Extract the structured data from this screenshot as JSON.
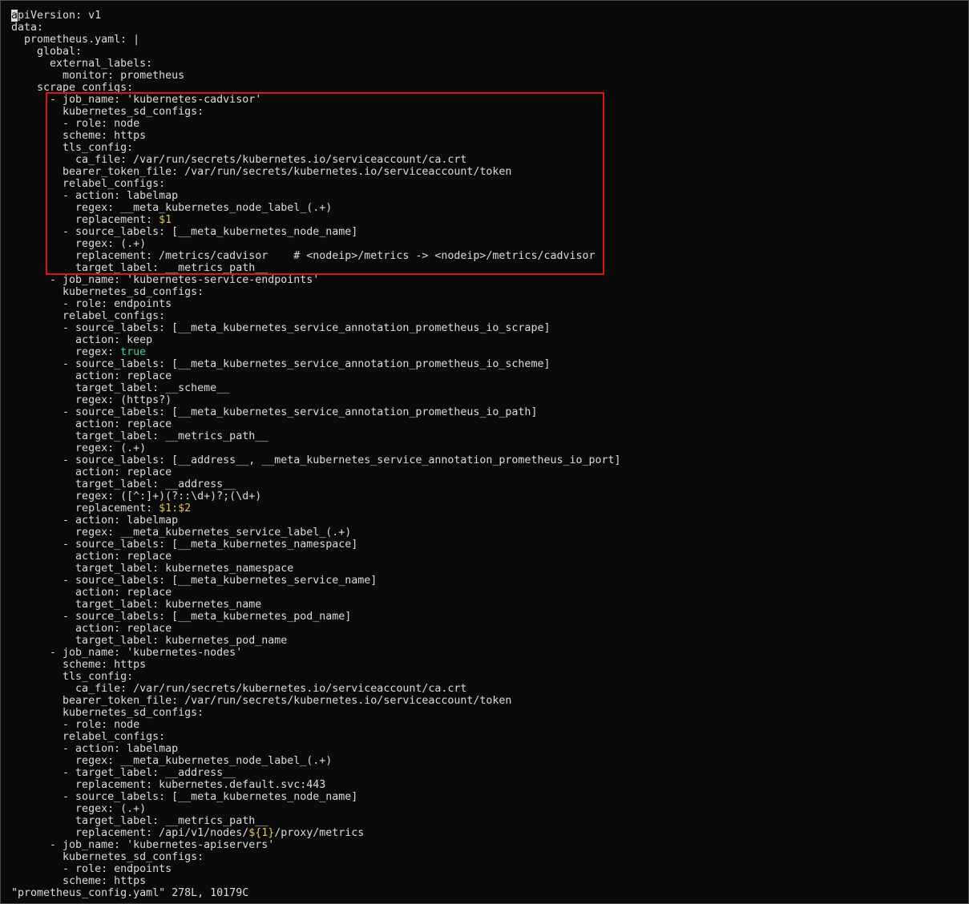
{
  "editor": {
    "lines": [
      "apiVersion: v1",
      "data:",
      "  prometheus.yaml: |",
      "    global:",
      "      external_labels:",
      "        monitor: prometheus",
      "    scrape_configs:",
      "      - job_name: 'kubernetes-cadvisor'",
      "        kubernetes_sd_configs:",
      "        - role: node",
      "        scheme: https",
      "        tls_config:",
      "          ca_file: /var/run/secrets/kubernetes.io/serviceaccount/ca.crt",
      "        bearer_token_file: /var/run/secrets/kubernetes.io/serviceaccount/token",
      "        relabel_configs:",
      "        - action: labelmap",
      "          regex: __meta_kubernetes_node_label_(.+)",
      "          replacement: $1",
      "        - source_labels: [__meta_kubernetes_node_name]",
      "          regex: (.+)",
      "          replacement: /metrics/cadvisor    # <nodeip>/metrics -> <nodeip>/metrics/cadvisor",
      "          target_label: __metrics_path__",
      "      - job_name: 'kubernetes-service-endpoints'",
      "        kubernetes_sd_configs:",
      "        - role: endpoints",
      "        relabel_configs:",
      "        - source_labels: [__meta_kubernetes_service_annotation_prometheus_io_scrape]",
      "          action: keep",
      "          regex: true",
      "        - source_labels: [__meta_kubernetes_service_annotation_prometheus_io_scheme]",
      "          action: replace",
      "          target_label: __scheme__",
      "          regex: (https?)",
      "        - source_labels: [__meta_kubernetes_service_annotation_prometheus_io_path]",
      "          action: replace",
      "          target_label: __metrics_path__",
      "          regex: (.+)",
      "        - source_labels: [__address__, __meta_kubernetes_service_annotation_prometheus_io_port]",
      "          action: replace",
      "          target_label: __address__",
      "          regex: ([^:]+)(?::\\d+)?;(\\d+)",
      "          replacement: $1:$2",
      "        - action: labelmap",
      "          regex: __meta_kubernetes_service_label_(.+)",
      "        - source_labels: [__meta_kubernetes_namespace]",
      "          action: replace",
      "          target_label: kubernetes_namespace",
      "        - source_labels: [__meta_kubernetes_service_name]",
      "          action: replace",
      "          target_label: kubernetes_name",
      "        - source_labels: [__meta_kubernetes_pod_name]",
      "          action: replace",
      "          target_label: kubernetes_pod_name",
      "      - job_name: 'kubernetes-nodes'",
      "        scheme: https",
      "        tls_config:",
      "          ca_file: /var/run/secrets/kubernetes.io/serviceaccount/ca.crt",
      "        bearer_token_file: /var/run/secrets/kubernetes.io/serviceaccount/token",
      "        kubernetes_sd_configs:",
      "        - role: node",
      "        relabel_configs:",
      "        - action: labelmap",
      "          regex: __meta_kubernetes_node_label_(.+)",
      "        - target_label: __address__",
      "          replacement: kubernetes.default.svc:443",
      "        - source_labels: [__meta_kubernetes_node_name]",
      "          regex: (.+)",
      "          target_label: __metrics_path__",
      "          replacement: /api/v1/nodes/${1}/proxy/metrics",
      "      - job_name: 'kubernetes-apiservers'",
      "        kubernetes_sd_configs:",
      "        - role: endpoints",
      "        scheme: https"
    ],
    "highlight_tokens": [
      "$1:$2",
      "$1",
      "${1}",
      "true"
    ],
    "status_line": "\"prometheus_config.yaml\" 278L, 10179C"
  },
  "colors": {
    "background": "#0a0a0a",
    "text": "#dcdcdc",
    "variable": "#e5c15a",
    "boolean": "#3fd48a",
    "highlight_box": "#d8141a"
  }
}
